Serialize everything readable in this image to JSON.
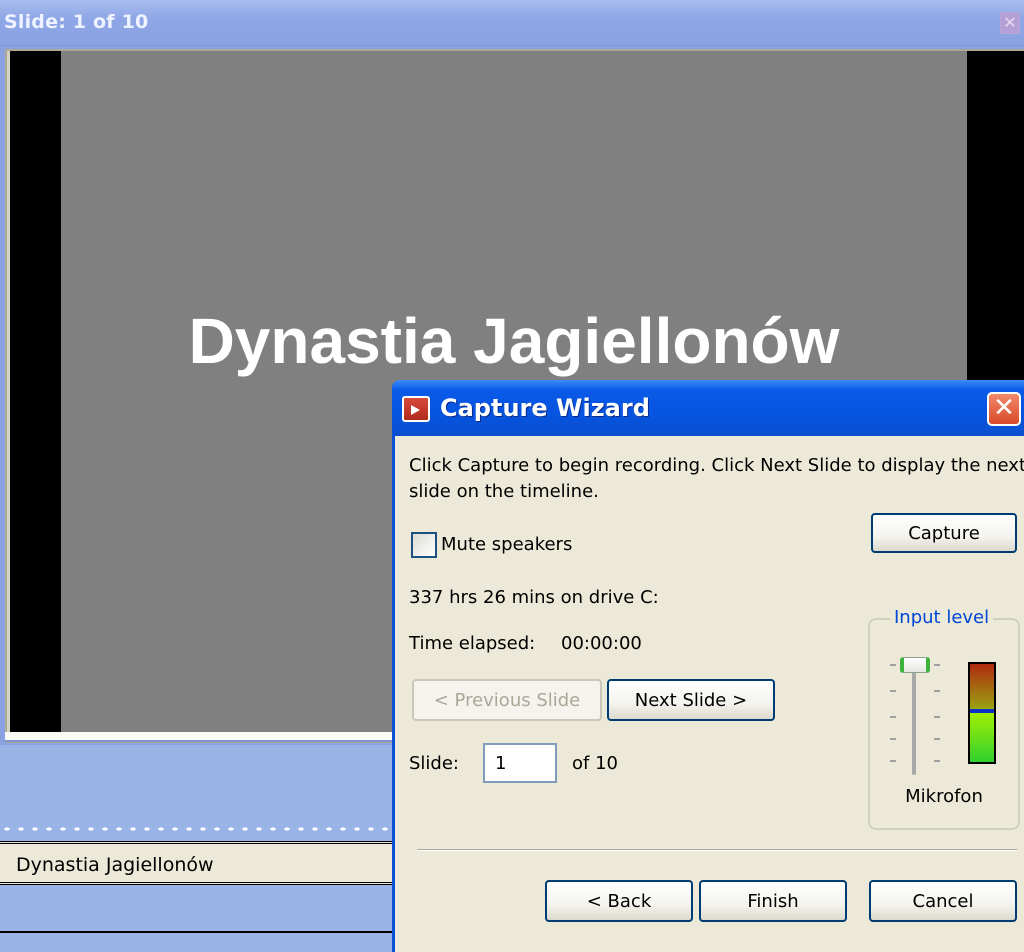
{
  "window": {
    "title": "Slide: 1 of 10",
    "close_icon": "close-icon"
  },
  "slide": {
    "title": "Dynastia Jagiellonów"
  },
  "timeline": {
    "track_label": "Dynastia Jagiellonów"
  },
  "wizard": {
    "title": "Capture Wizard",
    "icon": "capture-wizard-icon",
    "close_symbol": "✕",
    "instructions": "Click Capture to begin recording. Click Next Slide to display the next slide on the timeline.",
    "mute_speakers": {
      "label": "Mute speakers",
      "checked": false
    },
    "capture_label": "Capture",
    "disk_space": "337 hrs 26 mins on drive C:",
    "time_elapsed_label": "Time elapsed:",
    "time_elapsed_value": "00:00:00",
    "previous_slide_label": "< Previous Slide",
    "previous_slide_enabled": false,
    "next_slide_label": "Next Slide >",
    "slide_label": "Slide:",
    "slide_value": "1",
    "slide_of": "of 10",
    "input_level": {
      "title": "Input level",
      "source": "Mikrofon",
      "slider_fraction": 1.0,
      "meter_marker_fraction": 0.48
    },
    "back_label": "< Back",
    "finish_label": "Finish",
    "cancel_label": "Cancel"
  }
}
